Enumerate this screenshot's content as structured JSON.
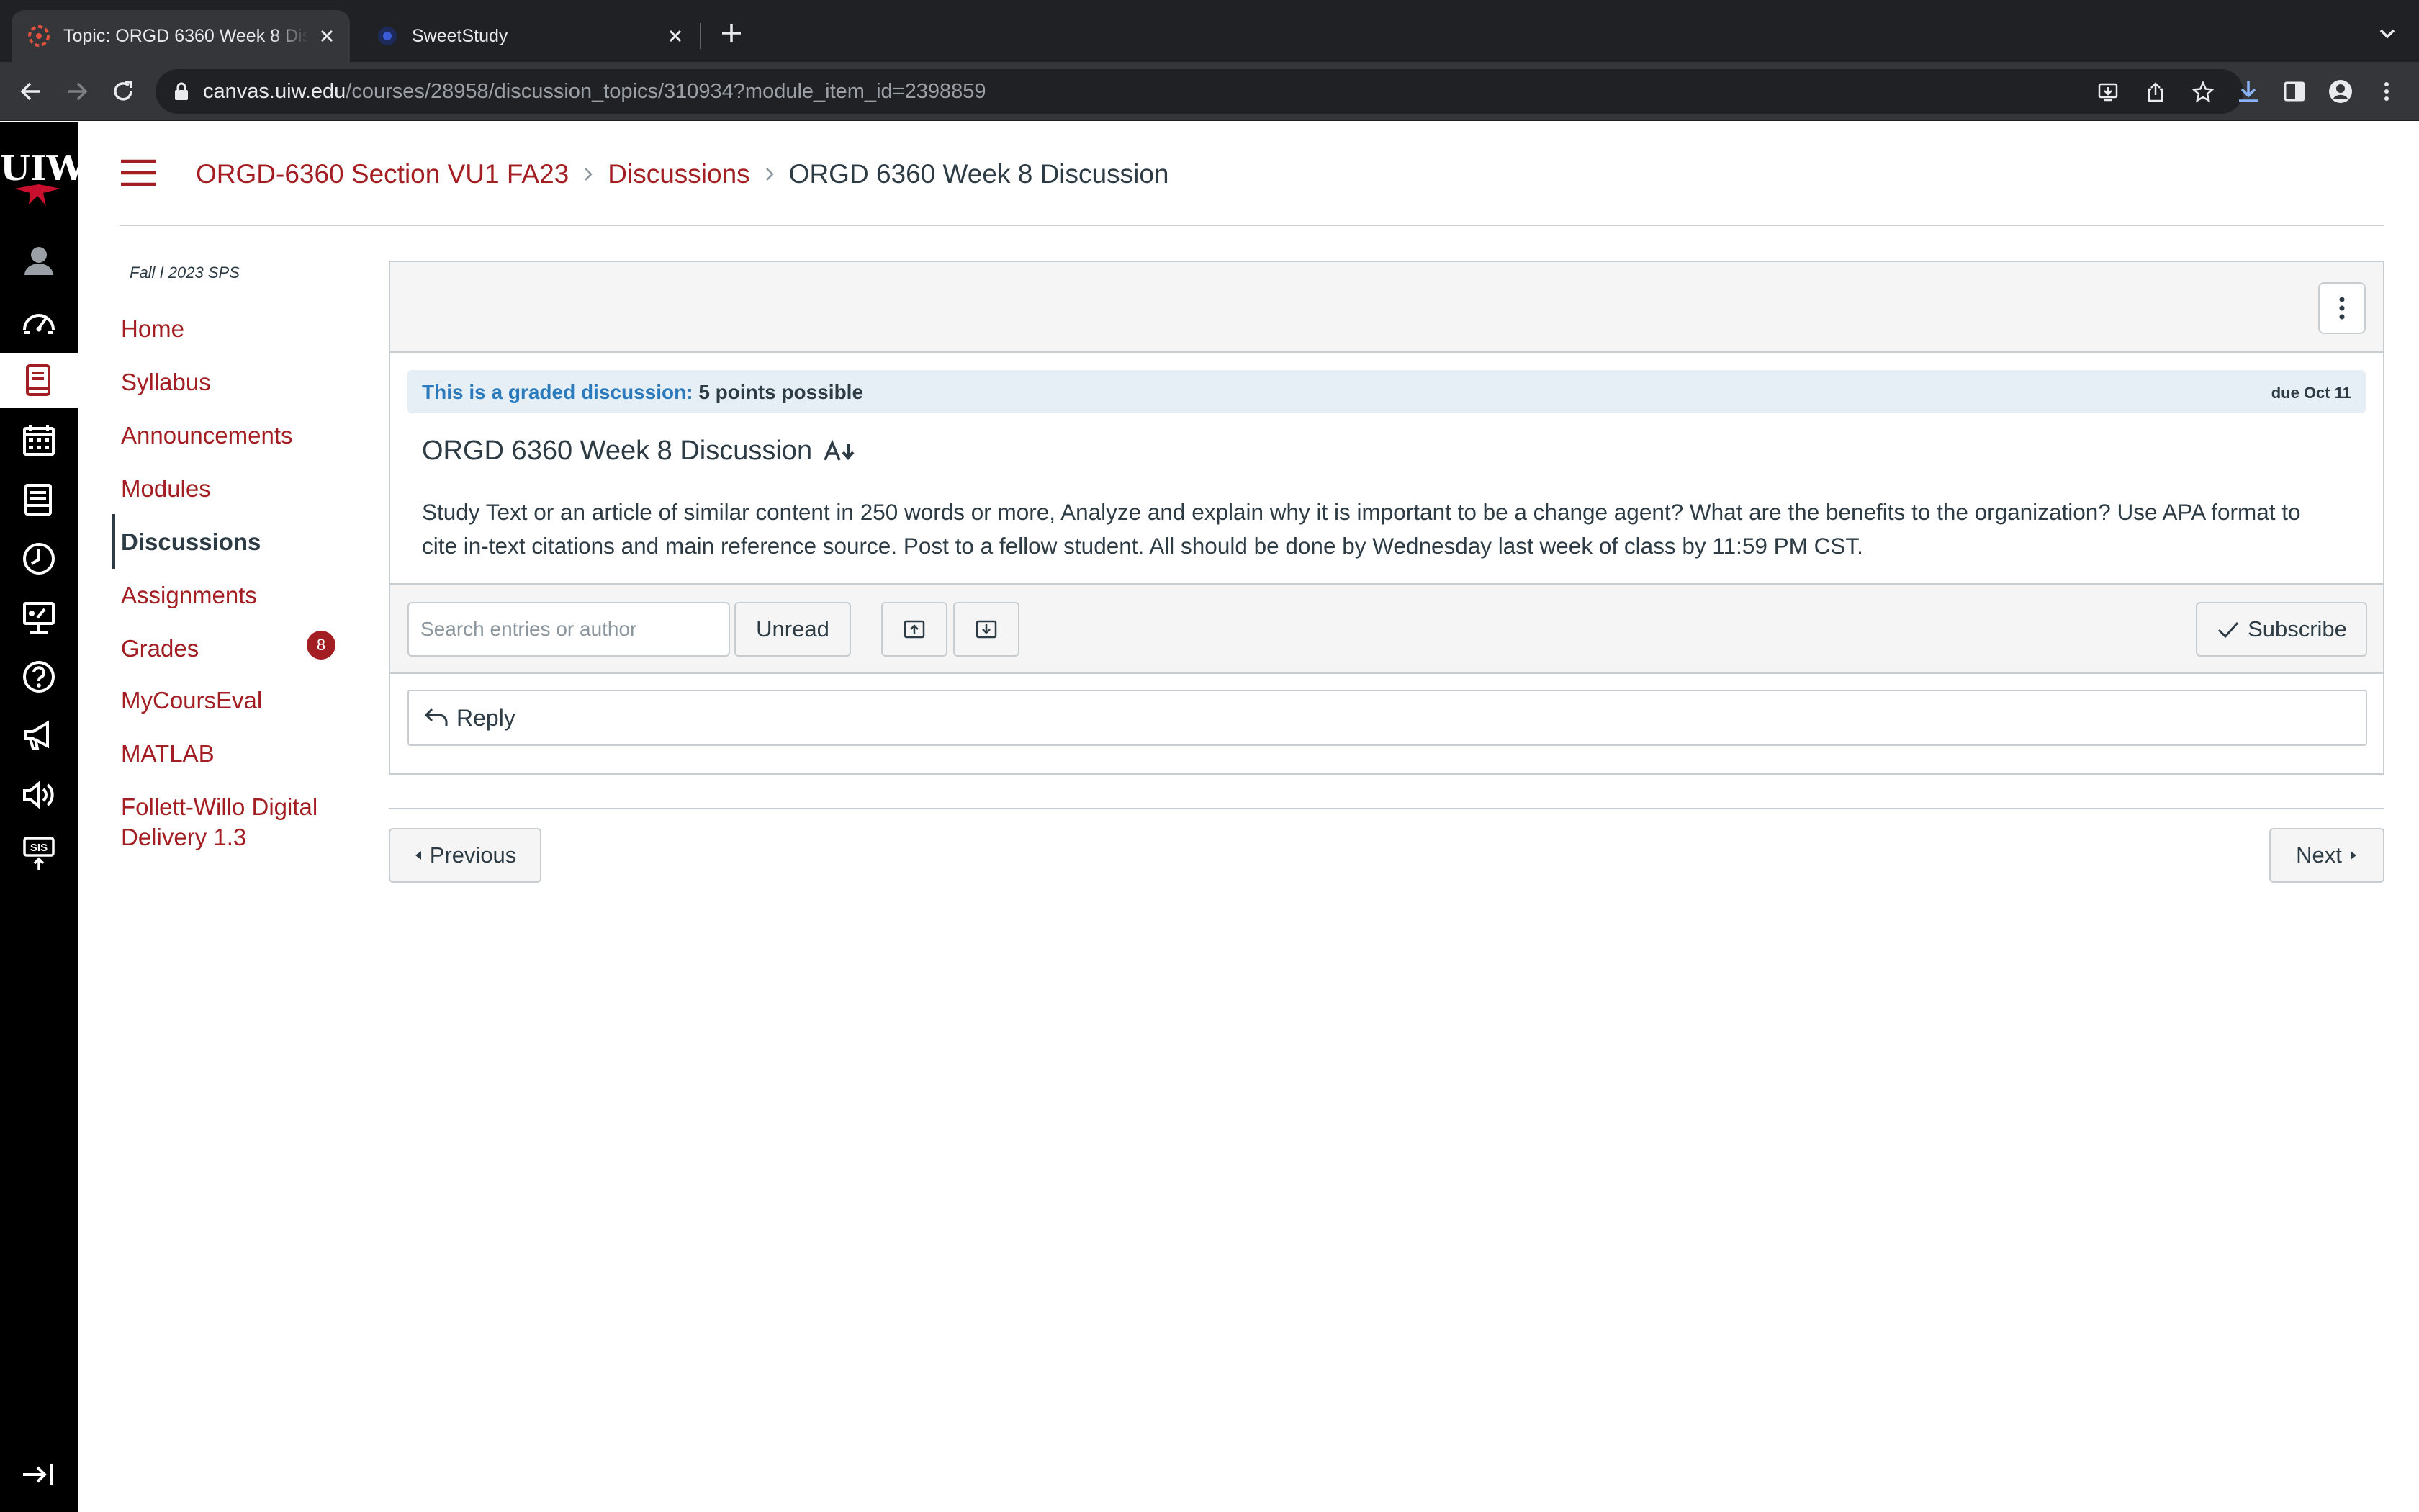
{
  "browser": {
    "tabs": [
      {
        "title": "Topic: ORGD 6360 Week 8 Discussion",
        "active": true
      },
      {
        "title": "SweetStudy",
        "active": false
      }
    ],
    "url_host": "canvas.uiw.edu",
    "url_path": "/courses/28958/discussion_topics/310934?module_item_id=2398859"
  },
  "global_nav": {
    "logo_text": "UIW",
    "items": [
      "account",
      "dashboard",
      "courses",
      "calendar",
      "inbox",
      "history",
      "studio",
      "help",
      "announcements",
      "accessibility",
      "sis"
    ]
  },
  "breadcrumb": {
    "course": "ORGD-6360 Section VU1 FA23",
    "section": "Discussions",
    "current": "ORGD 6360 Week 8 Discussion"
  },
  "course_nav": {
    "term": "Fall I 2023 SPS",
    "links": [
      {
        "label": "Home"
      },
      {
        "label": "Syllabus"
      },
      {
        "label": "Announcements"
      },
      {
        "label": "Modules"
      },
      {
        "label": "Discussions",
        "active": true
      },
      {
        "label": "Assignments"
      },
      {
        "label": "Grades",
        "badge": "8"
      },
      {
        "label": "MyCoursEval"
      },
      {
        "label": "MATLAB"
      },
      {
        "label": "Follett-Willo Digital",
        "label2": "Delivery 1.3"
      }
    ]
  },
  "discussion": {
    "graded_label": "This is a graded discussion:",
    "points": "5 points possible",
    "due": "due Oct 11",
    "title": "ORGD 6360 Week 8 Discussion",
    "body_line1": "Study Text or an article of similar content in 250 words or more, Analyze and explain why it is important to be a change agent? What are the benefits to the organization? Use APA format to",
    "body_line2": "cite in-text citations and main reference source. Post to a fellow student. All should be done by Wednesday last week of class by 11:59 PM CST."
  },
  "toolbar": {
    "search_placeholder": "Search entries or author",
    "unread_label": "Unread",
    "subscribe_label": "Subscribe"
  },
  "reply": {
    "label": "Reply"
  },
  "pager": {
    "previous": "Previous",
    "next": "Next"
  },
  "colors": {
    "brand": "#a31e22",
    "text": "#2d3b45",
    "info": "#2b7abc"
  }
}
